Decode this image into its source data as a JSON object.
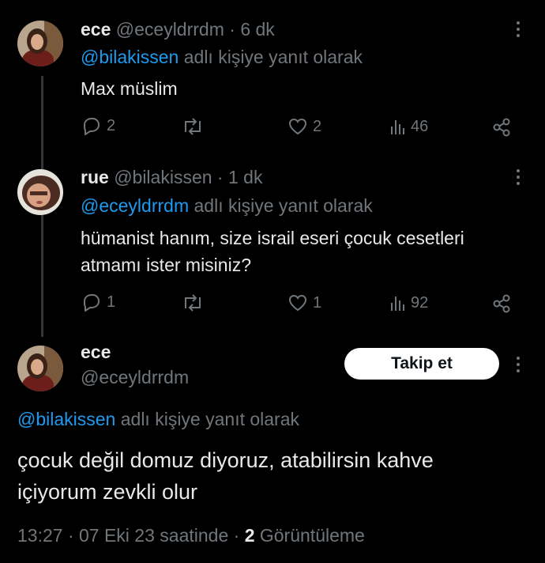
{
  "tweets": [
    {
      "display_name": "ece",
      "handle": "@eceyldrrdm",
      "time": "· 6 dk",
      "reply_to": "@bilakissen",
      "reply_suffix": "adlı kişiye yanıt olarak",
      "text": "Max müslim",
      "replies": "2",
      "retweets": "",
      "likes": "2",
      "views": "46"
    },
    {
      "display_name": "rue",
      "handle": "@bilakissen",
      "time": "· 1 dk",
      "reply_to": "@eceyldrrdm",
      "reply_suffix": "adlı kişiye yanıt olarak",
      "text_line1": "hümanist hanım, size israil eseri çocuk cesetleri",
      "text_line2": "atmamı ister misiniz?",
      "replies": "1",
      "retweets": "",
      "likes": "1",
      "views": "92"
    }
  ],
  "focused": {
    "display_name": "ece",
    "handle": "@eceyldrrdm",
    "follow_label": "Takip et",
    "reply_to": "@bilakissen",
    "reply_suffix": "adlı kişiye yanıt olarak",
    "text_line1": "çocuk değil domuz diyoruz, atabilirsin kahve",
    "text_line2": "içiyorum zevkli olur",
    "timestamp": "13:27 · 07 Eki 23 saatinde ·",
    "views_count": "2",
    "views_label": "Görüntüleme"
  },
  "colors": {
    "background": "#000000",
    "link": "#1d9bf0",
    "muted": "#71767b",
    "text": "#e7e9ea"
  }
}
